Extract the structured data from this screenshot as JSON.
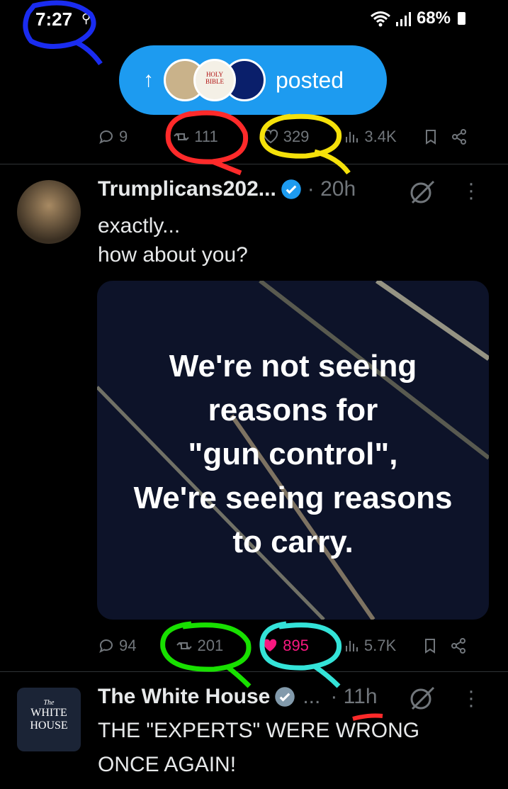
{
  "status_bar": {
    "time": "7:27",
    "battery": "68%"
  },
  "posted_pill": {
    "label": "posted",
    "avatar_text": "HOLY BIBLE"
  },
  "tweet1_actions": {
    "replies": "9",
    "reposts": "111",
    "likes": "329",
    "views": "3.4K"
  },
  "tweet2": {
    "author": "Trumplicans202...",
    "time": "· 20h",
    "text_line1": "exactly...",
    "text_line2": "how about you?",
    "image_text": [
      "We're not seeing",
      "reasons for",
      "\"gun control\",",
      "We're seeing reasons",
      "to carry."
    ],
    "actions": {
      "replies": "94",
      "reposts": "201",
      "likes": "895",
      "views": "5.7K"
    }
  },
  "tweet3": {
    "author": "The White House",
    "ellipsis": "...",
    "time": "· 11h",
    "text_line1": "THE \"EXPERTS\" WERE WRONG",
    "text_line2": "ONCE AGAIN!",
    "logo_small": "The",
    "logo_line1": "WHITE",
    "logo_line2": "HOUSE"
  },
  "colors": {
    "accent": "#1d9bf0",
    "muted": "#71767b",
    "like_pink": "#f91880",
    "mark_blue": "#1a2cf0",
    "mark_red": "#ff2a2a",
    "mark_yellow": "#f5e10a",
    "mark_green": "#18e000",
    "mark_cyan": "#34e3d8"
  }
}
